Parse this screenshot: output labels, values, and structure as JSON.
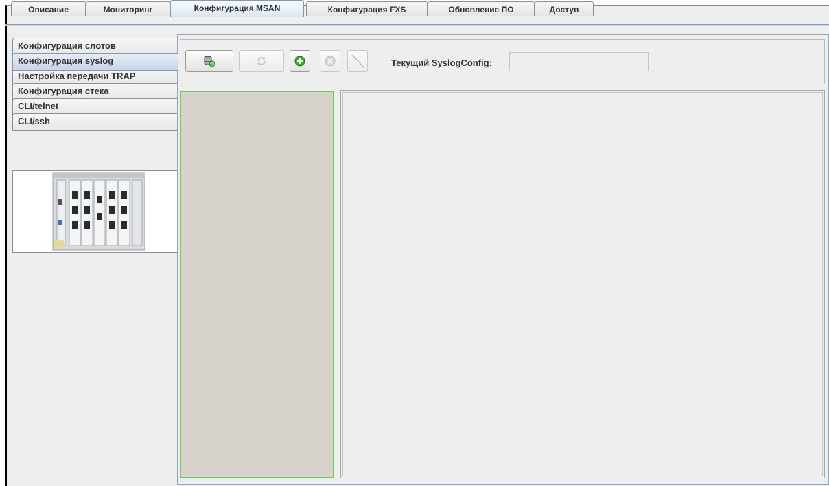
{
  "tabs": [
    {
      "label": "Описание",
      "active": false
    },
    {
      "label": "Мониторинг",
      "active": false
    },
    {
      "label": "Конфигурация MSAN",
      "active": true
    },
    {
      "label": "Конфигурация FXS",
      "active": false
    },
    {
      "label": "Обновление ПО",
      "active": false
    },
    {
      "label": "Доступ",
      "active": false
    }
  ],
  "sidebar": {
    "items": [
      {
        "label": "Конфигурация слотов",
        "active": false
      },
      {
        "label": "Конфигурация syslog",
        "active": true
      },
      {
        "label": "Настройка передачи TRAP",
        "active": false
      },
      {
        "label": "Конфигурация стека",
        "active": false
      },
      {
        "label": "CLI/telnet",
        "active": false
      },
      {
        "label": "CLI/ssh",
        "active": false
      }
    ],
    "device_image_icon": "msan-chassis-image"
  },
  "toolbar": {
    "buttons": [
      {
        "icon": "database-refresh-icon",
        "enabled": true
      },
      {
        "icon": "refresh-icon",
        "enabled": false
      },
      {
        "icon": "add-icon",
        "enabled": true
      },
      {
        "icon": "remove-icon",
        "enabled": false
      },
      {
        "icon": "edit-icon",
        "enabled": false
      }
    ],
    "current_label": "Текущий SyslogConfig:",
    "current_value": ""
  },
  "colors": {
    "list_background": "#d7d2cc",
    "list_border": "#77c46a",
    "active_tab": "#dbe6f2",
    "add_icon": "#3daa2e"
  }
}
